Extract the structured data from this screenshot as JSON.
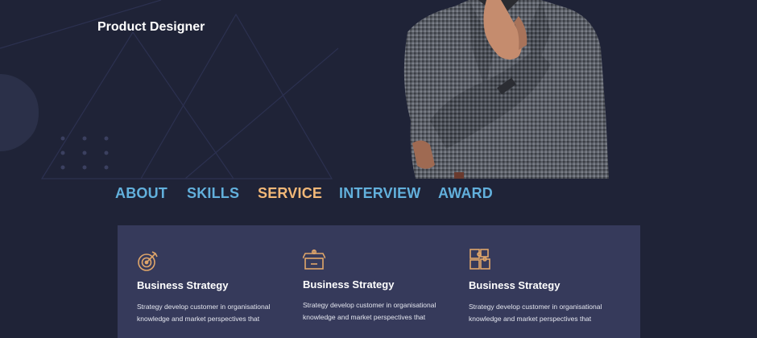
{
  "hero": {
    "subtitle": "Product Designer"
  },
  "nav": {
    "items": [
      {
        "label": "ABOUT",
        "active": false
      },
      {
        "label": "SKILLS",
        "active": false
      },
      {
        "label": "SERVICE",
        "active": true
      },
      {
        "label": "INTERVIEW",
        "active": false
      },
      {
        "label": "AWARD",
        "active": false
      }
    ]
  },
  "services": [
    {
      "icon": "target-icon",
      "title": "Business Strategy",
      "text": "Strategy develop customer in organisational knowledge and market perspectives that"
    },
    {
      "icon": "gift-box-icon",
      "title": "Business Strategy",
      "text": "Strategy develop customer in organisational knowledge and market perspectives that"
    },
    {
      "icon": "puzzle-icon",
      "title": "Business Strategy",
      "text": "Strategy develop customer in organisational knowledge and market perspectives that"
    }
  ],
  "colors": {
    "background": "#1f2337",
    "panel": "#363a5b",
    "nav_link": "#62b0dc",
    "nav_active": "#f2b878",
    "icon_accent": "#e0a66a"
  }
}
